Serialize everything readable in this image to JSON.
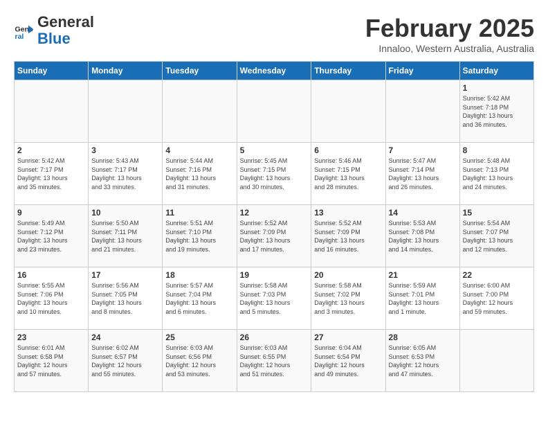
{
  "header": {
    "logo_line1": "General",
    "logo_line2": "Blue",
    "month": "February 2025",
    "location": "Innaloo, Western Australia, Australia"
  },
  "days_of_week": [
    "Sunday",
    "Monday",
    "Tuesday",
    "Wednesday",
    "Thursday",
    "Friday",
    "Saturday"
  ],
  "weeks": [
    [
      {
        "day": "",
        "info": ""
      },
      {
        "day": "",
        "info": ""
      },
      {
        "day": "",
        "info": ""
      },
      {
        "day": "",
        "info": ""
      },
      {
        "day": "",
        "info": ""
      },
      {
        "day": "",
        "info": ""
      },
      {
        "day": "1",
        "info": "Sunrise: 5:42 AM\nSunset: 7:18 PM\nDaylight: 13 hours\nand 36 minutes."
      }
    ],
    [
      {
        "day": "2",
        "info": "Sunrise: 5:42 AM\nSunset: 7:17 PM\nDaylight: 13 hours\nand 35 minutes."
      },
      {
        "day": "3",
        "info": "Sunrise: 5:43 AM\nSunset: 7:17 PM\nDaylight: 13 hours\nand 33 minutes."
      },
      {
        "day": "4",
        "info": "Sunrise: 5:44 AM\nSunset: 7:16 PM\nDaylight: 13 hours\nand 31 minutes."
      },
      {
        "day": "5",
        "info": "Sunrise: 5:45 AM\nSunset: 7:15 PM\nDaylight: 13 hours\nand 30 minutes."
      },
      {
        "day": "6",
        "info": "Sunrise: 5:46 AM\nSunset: 7:15 PM\nDaylight: 13 hours\nand 28 minutes."
      },
      {
        "day": "7",
        "info": "Sunrise: 5:47 AM\nSunset: 7:14 PM\nDaylight: 13 hours\nand 26 minutes."
      },
      {
        "day": "8",
        "info": "Sunrise: 5:48 AM\nSunset: 7:13 PM\nDaylight: 13 hours\nand 24 minutes."
      }
    ],
    [
      {
        "day": "9",
        "info": "Sunrise: 5:49 AM\nSunset: 7:12 PM\nDaylight: 13 hours\nand 23 minutes."
      },
      {
        "day": "10",
        "info": "Sunrise: 5:50 AM\nSunset: 7:11 PM\nDaylight: 13 hours\nand 21 minutes."
      },
      {
        "day": "11",
        "info": "Sunrise: 5:51 AM\nSunset: 7:10 PM\nDaylight: 13 hours\nand 19 minutes."
      },
      {
        "day": "12",
        "info": "Sunrise: 5:52 AM\nSunset: 7:09 PM\nDaylight: 13 hours\nand 17 minutes."
      },
      {
        "day": "13",
        "info": "Sunrise: 5:52 AM\nSunset: 7:09 PM\nDaylight: 13 hours\nand 16 minutes."
      },
      {
        "day": "14",
        "info": "Sunrise: 5:53 AM\nSunset: 7:08 PM\nDaylight: 13 hours\nand 14 minutes."
      },
      {
        "day": "15",
        "info": "Sunrise: 5:54 AM\nSunset: 7:07 PM\nDaylight: 13 hours\nand 12 minutes."
      }
    ],
    [
      {
        "day": "16",
        "info": "Sunrise: 5:55 AM\nSunset: 7:06 PM\nDaylight: 13 hours\nand 10 minutes."
      },
      {
        "day": "17",
        "info": "Sunrise: 5:56 AM\nSunset: 7:05 PM\nDaylight: 13 hours\nand 8 minutes."
      },
      {
        "day": "18",
        "info": "Sunrise: 5:57 AM\nSunset: 7:04 PM\nDaylight: 13 hours\nand 6 minutes."
      },
      {
        "day": "19",
        "info": "Sunrise: 5:58 AM\nSunset: 7:03 PM\nDaylight: 13 hours\nand 5 minutes."
      },
      {
        "day": "20",
        "info": "Sunrise: 5:58 AM\nSunset: 7:02 PM\nDaylight: 13 hours\nand 3 minutes."
      },
      {
        "day": "21",
        "info": "Sunrise: 5:59 AM\nSunset: 7:01 PM\nDaylight: 13 hours\nand 1 minute."
      },
      {
        "day": "22",
        "info": "Sunrise: 6:00 AM\nSunset: 7:00 PM\nDaylight: 12 hours\nand 59 minutes."
      }
    ],
    [
      {
        "day": "23",
        "info": "Sunrise: 6:01 AM\nSunset: 6:58 PM\nDaylight: 12 hours\nand 57 minutes."
      },
      {
        "day": "24",
        "info": "Sunrise: 6:02 AM\nSunset: 6:57 PM\nDaylight: 12 hours\nand 55 minutes."
      },
      {
        "day": "25",
        "info": "Sunrise: 6:03 AM\nSunset: 6:56 PM\nDaylight: 12 hours\nand 53 minutes."
      },
      {
        "day": "26",
        "info": "Sunrise: 6:03 AM\nSunset: 6:55 PM\nDaylight: 12 hours\nand 51 minutes."
      },
      {
        "day": "27",
        "info": "Sunrise: 6:04 AM\nSunset: 6:54 PM\nDaylight: 12 hours\nand 49 minutes."
      },
      {
        "day": "28",
        "info": "Sunrise: 6:05 AM\nSunset: 6:53 PM\nDaylight: 12 hours\nand 47 minutes."
      },
      {
        "day": "",
        "info": ""
      }
    ]
  ]
}
